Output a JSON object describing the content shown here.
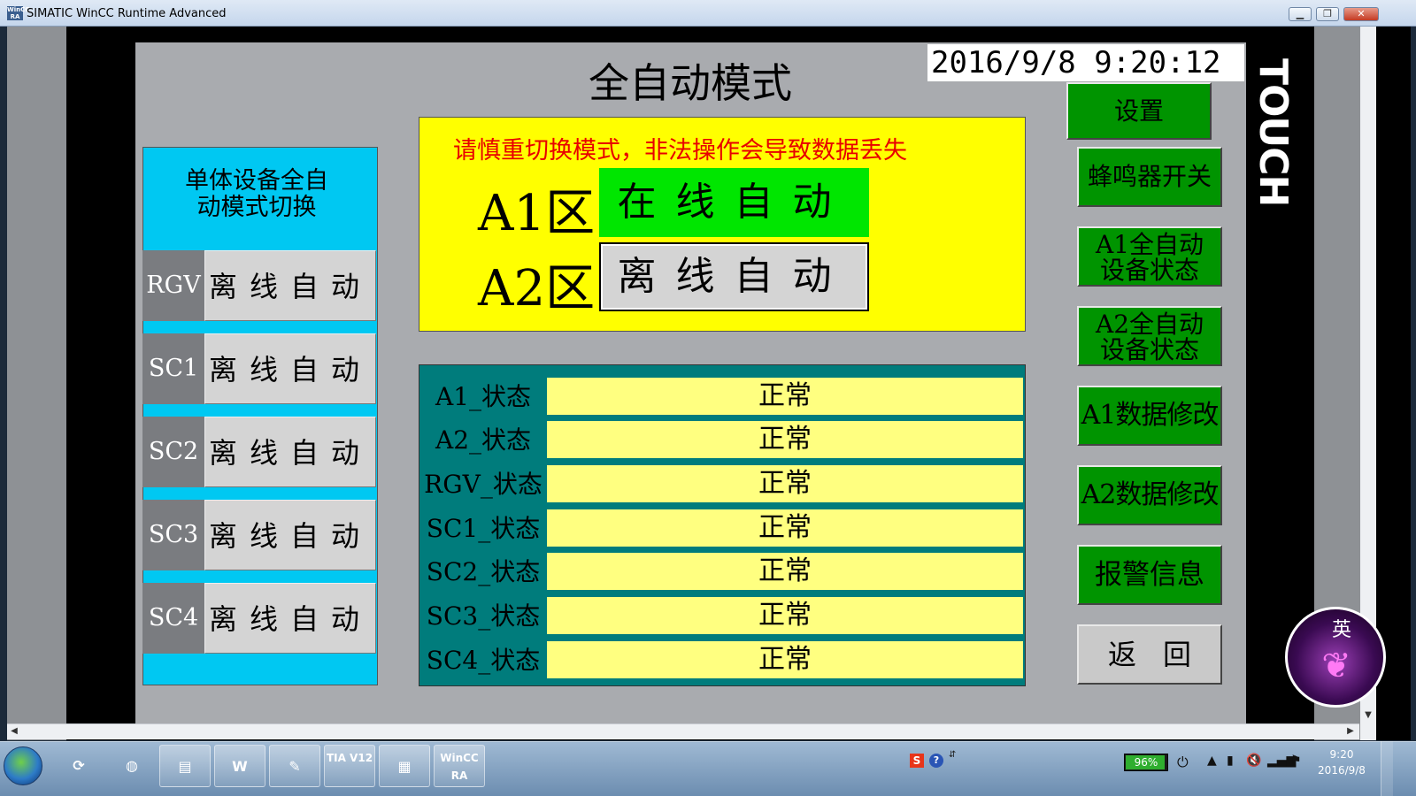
{
  "window": {
    "title": "SIMATIC WinCC Runtime Advanced",
    "app_icon_text": "WinCC RA",
    "min_glyph": "▁",
    "restore_glyph": "❐",
    "close_glyph": "✕"
  },
  "touch_label": "TOUCH",
  "header": {
    "title": "全自动模式",
    "datetime": "2016/9/8 9:20:12"
  },
  "left_panel": {
    "title": "单体设备全自动动模式切换",
    "title_line1": "单体设备全自",
    "title_line2": "动模式切换",
    "devices": [
      {
        "name": "RGV",
        "mode": "离线自动"
      },
      {
        "name": "SC1",
        "mode": "离线自动"
      },
      {
        "name": "SC2",
        "mode": "离线自动"
      },
      {
        "name": "SC3",
        "mode": "离线自动"
      },
      {
        "name": "SC4",
        "mode": "离线自动"
      }
    ]
  },
  "mode_panel": {
    "warning": "请慎重切换模式，非法操作会导致数据丢失",
    "zones": [
      {
        "label": "A1区",
        "mode": "在线自动",
        "color": "#00e600"
      },
      {
        "label": "A2区",
        "mode": "离线自动",
        "color": "#d4d4d4"
      }
    ]
  },
  "status_table": {
    "rows": [
      {
        "label": "A1_状态",
        "value": "正常"
      },
      {
        "label": "A2_状态",
        "value": "正常"
      },
      {
        "label": "RGV_状态",
        "value": "正常"
      },
      {
        "label": "SC1_状态",
        "value": "正常"
      },
      {
        "label": "SC2_状态",
        "value": "正常"
      },
      {
        "label": "SC3_状态",
        "value": "正常"
      },
      {
        "label": "SC4_状态",
        "value": "正常"
      }
    ]
  },
  "right_buttons": {
    "settings": "设置",
    "buzzer": "蜂鸣器开关",
    "a1_status_line1": "A1全自动",
    "a1_status_line2": "设备状态",
    "a2_status_line1": "A2全自动",
    "a2_status_line2": "设备状态",
    "a1_data": "A1数据修改",
    "a2_data": "A2数据修改",
    "alarm": "报警信息",
    "back": "返回"
  },
  "ime": {
    "char": "英"
  },
  "taskbar": {
    "apps": [
      {
        "name": "sync",
        "label": "⟳"
      },
      {
        "name": "firefox",
        "label": "◍"
      },
      {
        "name": "explorer",
        "label": "▤"
      },
      {
        "name": "word",
        "label": "W"
      },
      {
        "name": "tool",
        "label": "✎"
      },
      {
        "name": "tia",
        "label": "TIA V12"
      },
      {
        "name": "simulator",
        "label": "▦"
      },
      {
        "name": "wincc",
        "label": "WinCC RA"
      }
    ],
    "tray": {
      "ime_s": "S",
      "help": "?",
      "small": "⇵",
      "battery": "96%",
      "battery_level": 0.96,
      "plug": "⏻",
      "flag": "▲",
      "network": "▮",
      "volume": "🔇",
      "signal": "▂▄▆",
      "action": "⚑"
    },
    "clock_time": "9:20",
    "clock_date": "2016/9/8"
  },
  "colors": {
    "accent_green": "#009400",
    "online_green": "#00e600",
    "panel_cyan": "#00c8f2",
    "panel_yellow": "#ffff00",
    "status_teal": "#007c7c",
    "status_value": "#ffff80",
    "warning_red": "#e80000"
  }
}
